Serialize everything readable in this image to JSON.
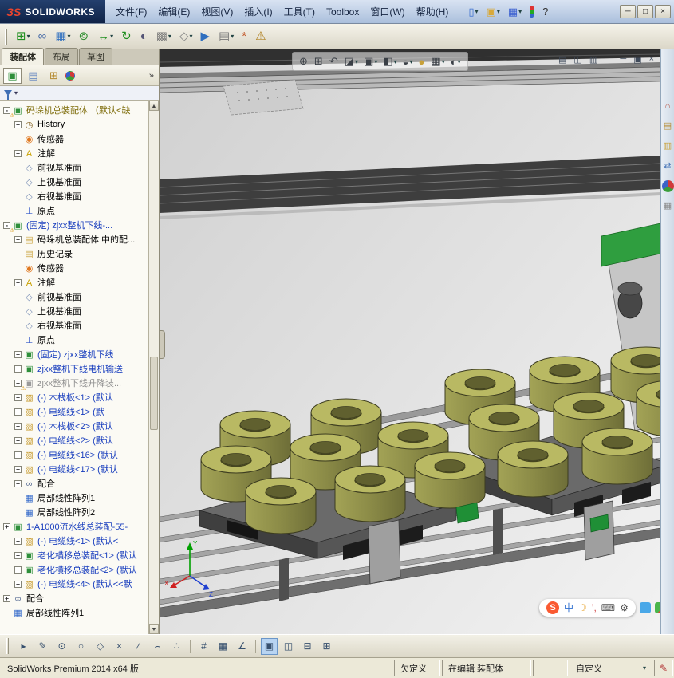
{
  "window": {
    "logo_prefix": "ЗS",
    "logo_name": "SOLIDWORKS",
    "menus": [
      "文件(F)",
      "编辑(E)",
      "视图(V)",
      "插入(I)",
      "工具(T)",
      "Toolbox",
      "窗口(W)",
      "帮助(H)"
    ],
    "quick_tools": [
      {
        "name": "new-document",
        "glyph": "▯",
        "color": "#3a6fd0",
        "dd": "▾"
      },
      {
        "name": "open-document",
        "glyph": "▣",
        "color": "#d8a93a",
        "dd": "▾"
      },
      {
        "name": "save-document",
        "glyph": "▦",
        "color": "#3a5fd0",
        "dd": "▾"
      },
      {
        "name": "options-lights",
        "glyph": "",
        "cls": "traffic"
      },
      {
        "name": "help",
        "glyph": "?",
        "color": "#333333"
      }
    ],
    "controls": [
      {
        "name": "minimize-button",
        "glyph": "─"
      },
      {
        "name": "maximize-button",
        "glyph": "□"
      },
      {
        "name": "close-button",
        "glyph": "×"
      }
    ]
  },
  "toolbar": {
    "items": [
      {
        "name": "insert-components",
        "glyph": "⊞",
        "color": "#1f8f1f",
        "dd": "▾"
      },
      {
        "name": "mate",
        "glyph": "∞",
        "color": "#4a6da8"
      },
      {
        "name": "linear-component-pattern",
        "glyph": "▦",
        "color": "#2f6fbf",
        "dd": "▾"
      },
      {
        "name": "smart-fasteners",
        "glyph": "⊚",
        "color": "#2f8f2f"
      },
      {
        "name": "move-component",
        "glyph": "↔",
        "color": "#1f8f1f",
        "dd": "▾"
      },
      {
        "name": "rotate-component",
        "glyph": "↻",
        "color": "#1f8f1f"
      },
      {
        "name": "show-hidden-components",
        "glyph": "◐",
        "color": "#555577"
      },
      {
        "name": "assembly-features",
        "glyph": "▩",
        "color": "#777777",
        "dd": "▾"
      },
      {
        "name": "reference-geometry",
        "glyph": "◇",
        "color": "#888888",
        "dd": "▾"
      },
      {
        "name": "new-motion-study",
        "glyph": "▶",
        "color": "#2f6fbf"
      },
      {
        "name": "bill-of-materials",
        "glyph": "▤",
        "color": "#777777",
        "dd": "▾"
      },
      {
        "name": "exploded-view",
        "glyph": "*",
        "color": "#c05020"
      },
      {
        "name": "interference-detection",
        "glyph": "⚠",
        "color": "#b08020"
      }
    ]
  },
  "left_panel": {
    "tabs": [
      {
        "label": "装配体",
        "cls": "active"
      },
      {
        "label": "布局",
        "cls": ""
      },
      {
        "label": "草图",
        "cls": ""
      }
    ],
    "manager_tabs": [
      {
        "name": "featuremanager-tab",
        "glyph": "▣",
        "color": "#2e8f3a",
        "cls": "mgr-active"
      },
      {
        "name": "propertymanager-tab",
        "glyph": "▤",
        "color": "#5a7fbf"
      },
      {
        "name": "configurationmanager-tab",
        "glyph": "⊞",
        "color": "#b58a2f"
      },
      {
        "name": "displaymanager-tab",
        "glyph": "",
        "cls": "ball"
      }
    ],
    "more_chevron": "»",
    "filter_dropdown": "▾",
    "tree": [
      {
        "pad": "2px",
        "exp": "-",
        "glyph": "▣",
        "glyph_color": "#2e8f3a",
        "warn": "⚠",
        "label": "码垛机总装配体 （默认<缺",
        "label_color": "#7d6b08"
      },
      {
        "pad": "16px",
        "exp": "+",
        "glyph": "◷",
        "glyph_color": "#8a6b2f",
        "label": "History"
      },
      {
        "pad": "16px",
        "glyph": "◉",
        "glyph_color": "#e07820",
        "label": "传感器"
      },
      {
        "pad": "16px",
        "exp": "+",
        "glyph": "A",
        "glyph_color": "#c9a100",
        "label": "注解"
      },
      {
        "pad": "16px",
        "glyph": "◇",
        "glyph_color": "#7f93b8",
        "label": "前视基准面"
      },
      {
        "pad": "16px",
        "glyph": "◇",
        "glyph_color": "#7f93b8",
        "label": "上视基准面"
      },
      {
        "pad": "16px",
        "glyph": "◇",
        "glyph_color": "#7f93b8",
        "label": "右视基准面"
      },
      {
        "pad": "16px",
        "glyph": "⊥",
        "glyph_color": "#2f55c9",
        "label": "原点"
      },
      {
        "pad": "2px",
        "exp": "-",
        "glyph": "▣",
        "glyph_color": "#2e8f3a",
        "warn": "⚠",
        "label": "(固定) zjxx整机下线-...",
        "label_color": "#1a3fbe"
      },
      {
        "pad": "16px",
        "exp": "+",
        "glyph": "▤",
        "glyph_color": "#caa23c",
        "label": "码垛机总装配体 中的配..."
      },
      {
        "pad": "16px",
        "glyph": "▤",
        "glyph_color": "#caa23c",
        "label": "历史记录"
      },
      {
        "pad": "16px",
        "glyph": "◉",
        "glyph_color": "#e07820",
        "label": "传感器"
      },
      {
        "pad": "16px",
        "exp": "+",
        "glyph": "A",
        "glyph_color": "#c9a100",
        "label": "注解"
      },
      {
        "pad": "16px",
        "glyph": "◇",
        "glyph_color": "#7f93b8",
        "label": "前视基准面"
      },
      {
        "pad": "16px",
        "glyph": "◇",
        "glyph_color": "#7f93b8",
        "label": "上视基准面"
      },
      {
        "pad": "16px",
        "glyph": "◇",
        "glyph_color": "#7f93b8",
        "label": "右视基准面"
      },
      {
        "pad": "16px",
        "glyph": "⊥",
        "glyph_color": "#2f55c9",
        "label": "原点"
      },
      {
        "pad": "16px",
        "exp": "+",
        "glyph": "▣",
        "glyph_color": "#2e8f3a",
        "label": "(固定) zjxx整机下线",
        "label_color": "#1a3fbe"
      },
      {
        "pad": "16px",
        "exp": "+",
        "glyph": "▣",
        "glyph_color": "#2e8f3a",
        "label": "zjxx整机下线电机输送",
        "label_color": "#1a3fbe"
      },
      {
        "pad": "16px",
        "exp": "+",
        "glyph": "▣",
        "glyph_color": "#9a9a9a",
        "warn": "⚠",
        "label": "zjxx整机下线升降装...",
        "label_color": "#909090"
      },
      {
        "pad": "16px",
        "exp": "+",
        "glyph": "▧",
        "glyph_color": "#c79b2e",
        "label": "(-) 木栈板<1> (默认",
        "label_color": "#1a3fbe"
      },
      {
        "pad": "16px",
        "exp": "+",
        "glyph": "▧",
        "glyph_color": "#c79b2e",
        "label": "(-) 电缆线<1> (默",
        "label_color": "#1a3fbe"
      },
      {
        "pad": "16px",
        "exp": "+",
        "glyph": "▧",
        "glyph_color": "#c79b2e",
        "label": "(-) 木栈板<2> (默认",
        "label_color": "#1a3fbe"
      },
      {
        "pad": "16px",
        "exp": "+",
        "glyph": "▧",
        "glyph_color": "#c79b2e",
        "label": "(-) 电缆线<2> (默认",
        "label_color": "#1a3fbe"
      },
      {
        "pad": "16px",
        "exp": "+",
        "glyph": "▧",
        "glyph_color": "#c79b2e",
        "label": "(-) 电缆线<16> (默认",
        "label_color": "#1a3fbe"
      },
      {
        "pad": "16px",
        "exp": "+",
        "glyph": "▧",
        "glyph_color": "#c79b2e",
        "label": "(-) 电缆线<17> (默认",
        "label_color": "#1a3fbe"
      },
      {
        "pad": "16px",
        "exp": "+",
        "glyph": "∞",
        "glyph_color": "#5b6f95",
        "label": "配合"
      },
      {
        "pad": "16px",
        "glyph": "▦",
        "glyph_color": "#2f66c9",
        "label": "局部线性阵列1"
      },
      {
        "pad": "16px",
        "glyph": "▦",
        "glyph_color": "#2f66c9",
        "label": "局部线性阵列2"
      },
      {
        "pad": "2px",
        "exp": "+",
        "glyph": "▣",
        "glyph_color": "#2e8f3a",
        "label": "1-A1000流水线总装配-55-",
        "label_color": "#1a3fbe"
      },
      {
        "pad": "16px",
        "exp": "+",
        "glyph": "▧",
        "glyph_color": "#c79b2e",
        "label": "(-) 电缆线<1> (默认<",
        "label_color": "#1a3fbe"
      },
      {
        "pad": "16px",
        "exp": "+",
        "glyph": "▣",
        "glyph_color": "#2e8f3a",
        "label": "老化横移总装配<1> (默认",
        "label_color": "#1a3fbe"
      },
      {
        "pad": "16px",
        "exp": "+",
        "glyph": "▣",
        "glyph_color": "#2e8f3a",
        "label": "老化横移总装配<2> (默认",
        "label_color": "#1a3fbe"
      },
      {
        "pad": "16px",
        "exp": "+",
        "glyph": "▧",
        "glyph_color": "#c79b2e",
        "label": "(-) 电缆线<4> (默认<<默",
        "label_color": "#1a3fbe"
      },
      {
        "pad": "2px",
        "exp": "+",
        "glyph": "∞",
        "glyph_color": "#5b6f95",
        "label": "配合"
      },
      {
        "pad": "2px",
        "glyph": "▦",
        "glyph_color": "#2f66c9",
        "label": "局部线性阵列1"
      }
    ]
  },
  "viewport": {
    "toolbar": [
      {
        "name": "zoom-to-fit",
        "glyph": "⊕"
      },
      {
        "name": "zoom-to-area",
        "glyph": "⊞"
      },
      {
        "name": "previous-view",
        "glyph": "↶"
      },
      {
        "name": "section-view",
        "glyph": "◪",
        "dd": "▾"
      },
      {
        "name": "view-orientation",
        "glyph": "▣",
        "dd": "▾"
      },
      {
        "name": "display-style",
        "glyph": "◧",
        "dd": "▾"
      },
      {
        "name": "hide-show-items",
        "glyph": "◒",
        "dd": "▾"
      },
      {
        "name": "edit-appearance",
        "glyph": "●",
        "color": "#c8a13a"
      },
      {
        "name": "apply-scene",
        "glyph": "▦",
        "dd": "▾"
      },
      {
        "name": "view-settings",
        "glyph": "◐",
        "dd": "▾"
      }
    ],
    "pane_left": [
      {
        "name": "split-view-icon",
        "glyph": "▤"
      },
      {
        "name": "pane-columns-icon",
        "glyph": "◫"
      },
      {
        "name": "pane-rows-icon",
        "glyph": "▥"
      }
    ],
    "pane_right": [
      {
        "name": "child-minimize-icon",
        "glyph": "─"
      },
      {
        "name": "child-restore-icon",
        "glyph": "▣"
      },
      {
        "name": "child-close-icon",
        "glyph": "×"
      }
    ],
    "ime": {
      "logo": "S",
      "items": [
        {
          "name": "ime-lang",
          "glyph": "中",
          "color": "#2f6fd0"
        },
        {
          "name": "ime-moon",
          "glyph": "☽",
          "color": "#e8a93a"
        },
        {
          "name": "ime-punct",
          "glyph": "’,",
          "color": "#d04545"
        },
        {
          "name": "ime-keyboard",
          "glyph": "⌨",
          "color": "#555555"
        },
        {
          "name": "ime-toolbox",
          "glyph": "⚙",
          "color": "#555555"
        }
      ]
    }
  },
  "taskpane": {
    "items": [
      {
        "name": "solidworks-resources",
        "glyph": "⌂",
        "color": "#b5432f"
      },
      {
        "name": "design-library",
        "glyph": "▤",
        "color": "#b58a2f"
      },
      {
        "name": "file-explorer",
        "glyph": "▥",
        "color": "#caa23c"
      },
      {
        "name": "view-palette",
        "glyph": "⇄",
        "color": "#3f6fb5"
      },
      {
        "name": "appearances-scenes",
        "glyph": "",
        "cls": "ball"
      },
      {
        "name": "custom-properties",
        "glyph": "▦",
        "color": "#888888"
      }
    ]
  },
  "sketchbar": {
    "items": [
      {
        "name": "select-tool",
        "glyph": "▸"
      },
      {
        "name": "sketch-tool",
        "glyph": "✎"
      },
      {
        "name": "circle-tool",
        "glyph": "⊙"
      },
      {
        "name": "ellipse-tool",
        "glyph": "○"
      },
      {
        "name": "polygon-tool",
        "glyph": "◇"
      },
      {
        "name": "trim-tool",
        "glyph": "×"
      },
      {
        "name": "line-tool",
        "glyph": "∕"
      },
      {
        "name": "arc-tool",
        "glyph": "⌢"
      },
      {
        "name": "point-tool",
        "glyph": "∴"
      },
      {
        "cls": "sep"
      },
      {
        "name": "snap-tool",
        "glyph": "#"
      },
      {
        "name": "grid-tool",
        "glyph": "▦"
      },
      {
        "name": "angle-tool",
        "glyph": "∠"
      },
      {
        "cls": "sep"
      },
      {
        "name": "viewport-single",
        "glyph": "▣",
        "cls": "active"
      },
      {
        "name": "viewport-two-vertical",
        "glyph": "◫"
      },
      {
        "name": "viewport-two-horizontal",
        "glyph": "⊟"
      },
      {
        "name": "viewport-four",
        "glyph": "⊞"
      }
    ]
  },
  "statusbar": {
    "product": "SolidWorks Premium 2014 x64 版",
    "definition": "欠定义",
    "editing": "在编辑 装配体",
    "custom": "自定义",
    "custom_arrow": "▾",
    "edit_icon": "✎"
  },
  "colors": {
    "titlebar": "#b9c8de",
    "chrome": "#ece9d8",
    "viewport_background": "#dcdcdc",
    "coil": "#b9b963",
    "pallet": "#5a5a5a",
    "reference_blue_text": "#1a3fbe",
    "accent_green": "#2e8f3a"
  }
}
